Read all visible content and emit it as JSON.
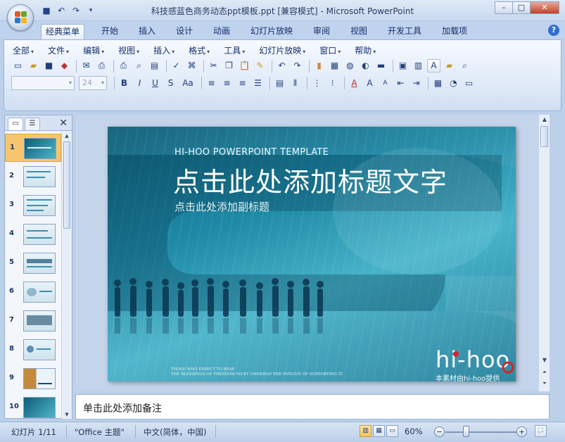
{
  "window": {
    "title": "科技感蓝色商务动态ppt模板.ppt [兼容模式] - Microsoft PowerPoint",
    "controls": [
      "–",
      "□",
      "✕"
    ]
  },
  "quick_access": {
    "icons": [
      "save-icon",
      "undo-icon",
      "redo-icon",
      "customize-icon"
    ]
  },
  "tabs": [
    "经典菜单",
    "开始",
    "插入",
    "设计",
    "动画",
    "幻灯片放映",
    "审阅",
    "视图",
    "开发工具",
    "加载项"
  ],
  "active_tab": "经典菜单",
  "classic_menu": [
    {
      "label": "全部"
    },
    {
      "label": "文件"
    },
    {
      "label": "编辑"
    },
    {
      "label": "视图"
    },
    {
      "label": "插入"
    },
    {
      "label": "格式"
    },
    {
      "label": "工具"
    },
    {
      "label": "幻灯片放映"
    },
    {
      "label": "窗口"
    },
    {
      "label": "帮助"
    }
  ],
  "format_bar": {
    "font_name_value": "",
    "font_size_value": "24",
    "bold": "B",
    "italic": "I",
    "underline": "U",
    "shadow": "S",
    "case": "Aa",
    "font_color_glyph": "A",
    "textbox_glyph": "A"
  },
  "left_panel": {
    "close": "✕",
    "slides": [
      {
        "num": "1"
      },
      {
        "num": "2"
      },
      {
        "num": "3"
      },
      {
        "num": "4"
      },
      {
        "num": "5"
      },
      {
        "num": "6"
      },
      {
        "num": "7"
      },
      {
        "num": "8"
      },
      {
        "num": "9"
      },
      {
        "num": "10"
      }
    ],
    "selected": "1"
  },
  "slide": {
    "label": "HI-HOO POWERPOINT TEMPLATE",
    "title": "点击此处添加标题文字",
    "subtitle": "点击此处添加副标题",
    "footer_line1": "THOSE WHO EXPECT TO REAP",
    "footer_line2": "THE BLESSINGS OF FREEDOM MUST UNDERGO THE FATIGUE OF SUPPORTING IT.",
    "logo": "hi-hoo",
    "logo_caption": "本素材由hi-hoo提供"
  },
  "notes": {
    "placeholder": "单击此处添加备注"
  },
  "status": {
    "slide_info": "幻灯片 1/11",
    "theme": "\"Office 主题\"",
    "language": "中文(简体，中国)",
    "zoom": "60%",
    "zoom_minus": "−",
    "zoom_plus": "+"
  },
  "colors": {
    "accent": "#f6c66e",
    "slide_dark": "#0d5d78",
    "slide_light": "#47b3c9",
    "logo_red": "#d8232a"
  }
}
